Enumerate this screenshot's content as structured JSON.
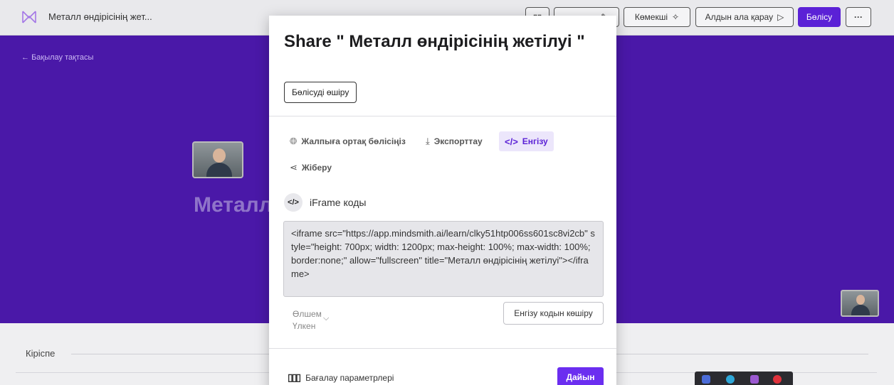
{
  "topbar": {
    "doc_title": "Металл өндірісінің жет...",
    "helper_label": "Көмекші",
    "helper_icon": "sparkle-icon",
    "preview_label": "Алдын ала қарау",
    "preview_icon": "play-outline-icon",
    "share_label": "Бөлісу",
    "more_icon": "ellipsis-icon"
  },
  "hero": {
    "back_label": "Бақылау тақтасы",
    "title": "Металл"
  },
  "page": {
    "section_label": "Кіріспе"
  },
  "modal": {
    "title": "Share \" Металл өндірісінің жетілуі \"",
    "stop_sharing_label": "Бөлісуді өшіру",
    "tabs": [
      {
        "label": "Жалпыға ортақ бөлісіңіз",
        "icon": "globe-icon"
      },
      {
        "label": "Экспорттау",
        "icon": "download-icon"
      },
      {
        "label": "Енгізу",
        "icon": "code-icon"
      },
      {
        "label": "Жіберу",
        "icon": "share-icon"
      }
    ],
    "active_tab": "Енгізу",
    "iframe_heading": "iFrame коды",
    "iframe_code": "<iframe src=\"https://app.mindsmith.ai/learn/clky51htp006ss601sc8vi2cb\" style=\"height: 700px; width: 1200px; max-height: 100%; max-width: 100%; border:none;\" allow=\"fullscreen\" title=\"Металл өндірісінің жетілуі\"></iframe>",
    "size_label": "Өлшем",
    "size_value": "Үлкен",
    "copy_label": "Енгізу кодын көшіру",
    "eval_label": "Бағалау параметрлері",
    "ready_label": "Дайын"
  },
  "colors": {
    "brand_purple": "#4a18a8",
    "accent": "#5b21d6",
    "ready_button": "#6b2ef0"
  }
}
